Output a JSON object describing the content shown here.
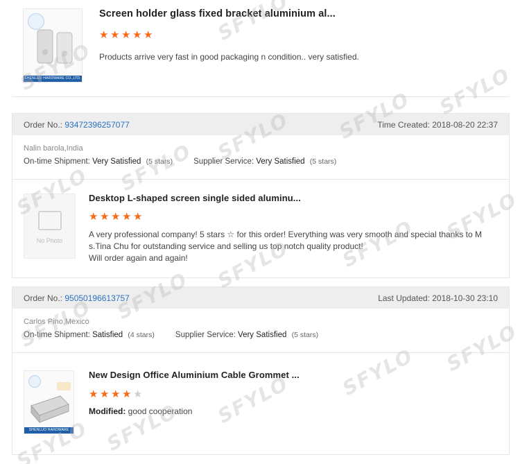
{
  "colors": {
    "accent_link": "#2a72c4",
    "star": "#f36c17",
    "star_empty": "#cfcfcf",
    "bar_bg": "#eeeeee"
  },
  "reviews": [
    {
      "product_title": "Screen holder glass fixed bracket aluminium al...",
      "stars_filled": 5,
      "review_text": "Products arrive very fast in good packaging n condition.. very satisfied.",
      "thumb_brand": "SHENLUO HARDWARE CO.,LTD."
    },
    {
      "order_label": "Order No.:",
      "order_no": "93472396257077",
      "time_label": "Time Created:",
      "time_value": "2018-08-20 22:37",
      "buyer": "Nalin barola,India",
      "shipment_label": "On-time Shipment:",
      "shipment_value": "Very Satisfied",
      "shipment_stars": "(5 stars)",
      "supplier_label": "Supplier Service:",
      "supplier_value": "Very Satisfied",
      "supplier_stars": "(5 stars)",
      "product_title": "Desktop L-shaped screen single sided aluminu...",
      "stars_filled": 5,
      "review_line1": "A very professional company! 5 stars ☆ for this order! Everything was very smooth and special thanks to M",
      "review_line2": "s.Tina Chu for outstanding service and selling us top notch quality product!",
      "review_line3": "Will order again and again!",
      "no_photo": "No Photo"
    },
    {
      "order_label": "Order No.:",
      "order_no": "95050196613757",
      "time_label": "Last Updated:",
      "time_value": "2018-10-30 23:10",
      "buyer": "Carlos Pino,Mexico",
      "shipment_label": "On-time Shipment:",
      "shipment_value": "Satisfied",
      "shipment_stars": "(4 stars)",
      "supplier_label": "Supplier Service:",
      "supplier_value": "Very Satisfied",
      "supplier_stars": "(5 stars)",
      "product_title": "New Design Office Aluminium Cable Grommet ...",
      "stars_filled": 4,
      "modified_label": "Modified:",
      "modified_text": "good cooperation",
      "thumb_brand": "SHENLUO HARDWARE CO.,LTD."
    }
  ],
  "watermark": "SFYLO"
}
